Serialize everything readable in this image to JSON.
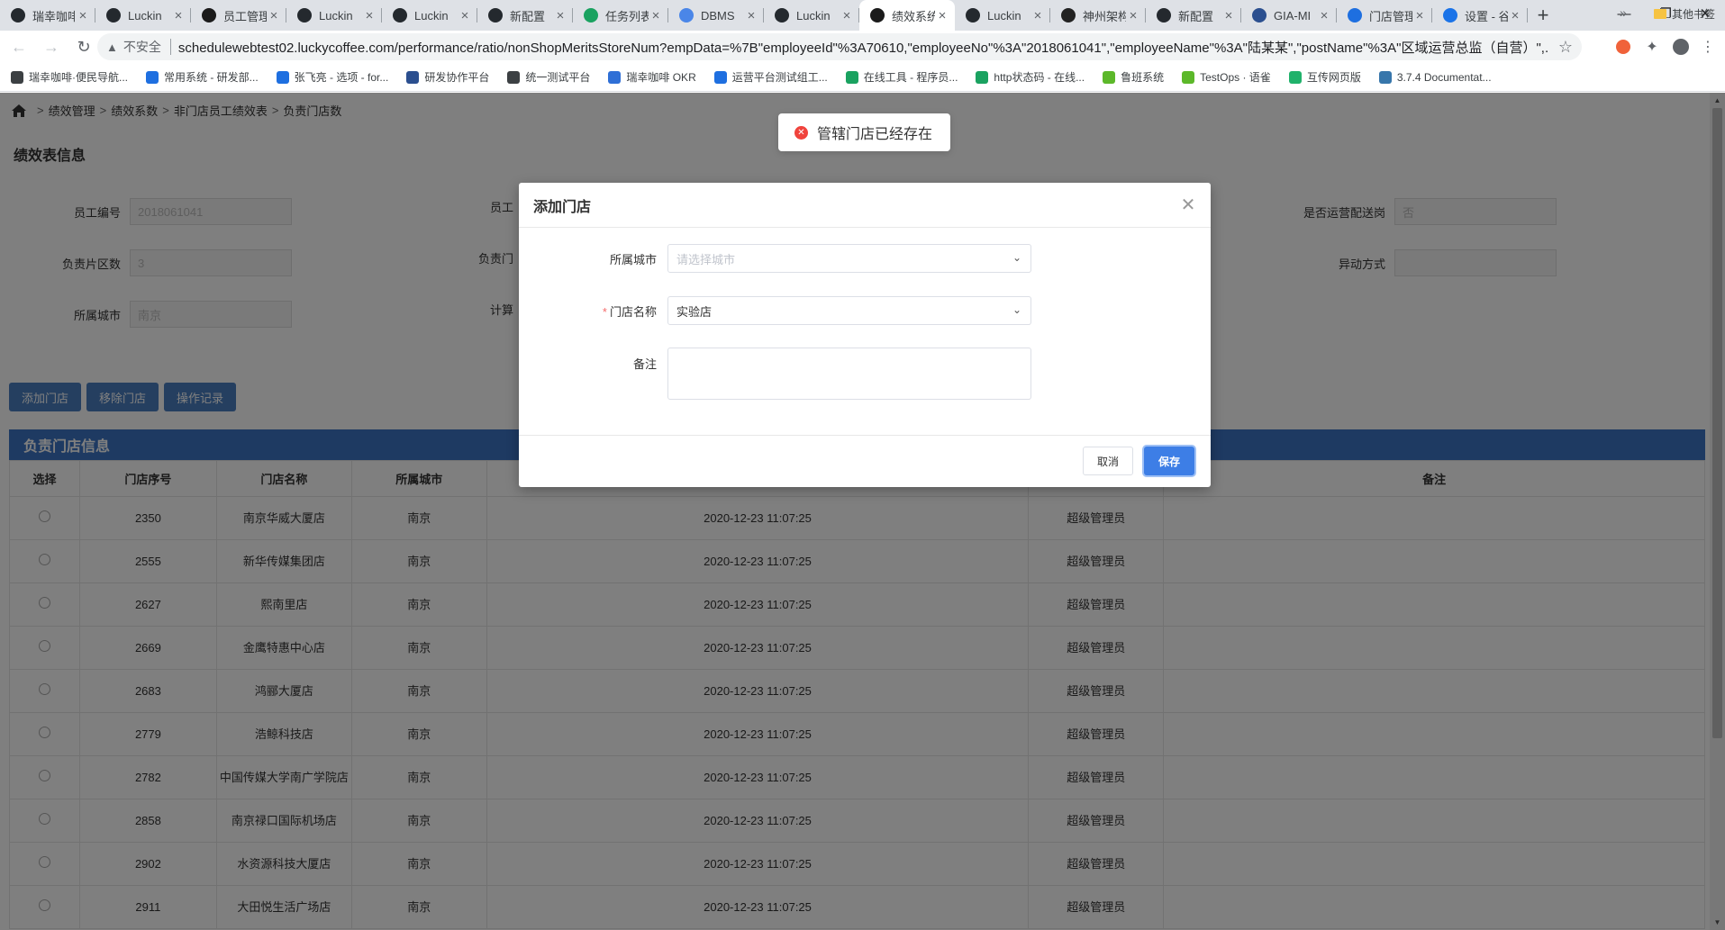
{
  "browser": {
    "tabs": [
      {
        "title": "瑞幸咖啡",
        "icon": "github-icon",
        "active": false
      },
      {
        "title": "Luckin",
        "icon": "github-icon",
        "active": false
      },
      {
        "title": "员工管理",
        "icon": "luckin-icon",
        "active": false
      },
      {
        "title": "Luckin",
        "icon": "github-icon",
        "active": false
      },
      {
        "title": "Luckin",
        "icon": "github-icon",
        "active": false
      },
      {
        "title": "新配置",
        "icon": "github-icon",
        "active": false
      },
      {
        "title": "任务列表",
        "icon": "clock-icon",
        "active": false
      },
      {
        "title": "DBMS",
        "icon": "doc-icon",
        "active": false
      },
      {
        "title": "Luckin",
        "icon": "github-icon",
        "active": false
      },
      {
        "title": "绩效系统",
        "icon": "luckin-icon",
        "active": true
      },
      {
        "title": "Luckin",
        "icon": "github-icon",
        "active": false
      },
      {
        "title": "神州架构",
        "icon": "ucar-icon",
        "active": false
      },
      {
        "title": "新配置",
        "icon": "github-icon",
        "active": false
      },
      {
        "title": "GIA-MI",
        "icon": "gia-icon",
        "active": false
      },
      {
        "title": "门店管理",
        "icon": "confluence-icon",
        "active": false
      },
      {
        "title": "设置 - 谷",
        "icon": "gear-icon",
        "active": false
      }
    ],
    "new_tab": "+",
    "insecure_label": "不安全",
    "url": "schedulewebtest02.luckycoffee.com/performance/ratio/nonShopMeritsStoreNum?empData=%7B\"employeeId\"%3A70610,\"employeeNo\"%3A\"2018061041\",\"employeeName\"%3A\"陆某某\",\"postName\"%3A\"区域运营总监（自营）\",...",
    "bookmarks": [
      {
        "label": "瑞幸咖啡·便民导航...",
        "color": "#3c4043"
      },
      {
        "label": "常用系统 - 研发部...",
        "color": "#1e6fe0"
      },
      {
        "label": "张飞亮 - 选项 - for...",
        "color": "#1e6fe0"
      },
      {
        "label": "研发协作平台",
        "color": "#2b4f8f"
      },
      {
        "label": "统一测试平台",
        "color": "#3c4043"
      },
      {
        "label": "瑞幸咖啡 OKR",
        "color": "#2f6fd6"
      },
      {
        "label": "运营平台测试组工...",
        "color": "#1e6fe0"
      },
      {
        "label": "在线工具 - 程序员...",
        "color": "#1aa260"
      },
      {
        "label": "http状态码 - 在线...",
        "color": "#1aa260"
      },
      {
        "label": "鲁班系统",
        "color": "#5cb82a"
      },
      {
        "label": "TestOps · 语雀",
        "color": "#5cb82a"
      },
      {
        "label": "互传网页版",
        "color": "#20b26b"
      },
      {
        "label": "3.7.4 Documentat...",
        "color": "#3776ab"
      }
    ],
    "bookmarks_more": "»",
    "other_bookmarks": "其他书签"
  },
  "page": {
    "breadcrumb": [
      "绩效管理",
      "绩效系数",
      "非门店员工绩效表",
      "负责门店数"
    ],
    "section_title": "绩效表信息",
    "fields": [
      {
        "label": "员工编号",
        "value": "2018061041"
      },
      {
        "label": "员工",
        "value": ""
      },
      {
        "label": "是否运营配送岗",
        "value": "否"
      },
      {
        "label": "负责片区数",
        "value": "3"
      },
      {
        "label": "负责门",
        "value": ""
      },
      {
        "label": "异动方式",
        "value": ""
      },
      {
        "label": "所属城市",
        "value": "南京"
      },
      {
        "label": "计算",
        "value": ""
      }
    ],
    "buttons": {
      "add": "添加门店",
      "remove": "移除门店",
      "log": "操作记录"
    },
    "table_title": "负责门店信息",
    "columns": [
      "选择",
      "门店序号",
      "门店名称",
      "所属城市",
      "",
      "",
      "备注"
    ],
    "rows": [
      {
        "num": "2350",
        "name": "南京华威大厦店",
        "city": "南京",
        "time": "2020-12-23 11:07:25",
        "operator": "超级管理员",
        "remark": ""
      },
      {
        "num": "2555",
        "name": "新华传媒集团店",
        "city": "南京",
        "time": "2020-12-23 11:07:25",
        "operator": "超级管理员",
        "remark": ""
      },
      {
        "num": "2627",
        "name": "熙南里店",
        "city": "南京",
        "time": "2020-12-23 11:07:25",
        "operator": "超级管理员",
        "remark": ""
      },
      {
        "num": "2669",
        "name": "金鹰特惠中心店",
        "city": "南京",
        "time": "2020-12-23 11:07:25",
        "operator": "超级管理员",
        "remark": ""
      },
      {
        "num": "2683",
        "name": "鸿郦大厦店",
        "city": "南京",
        "time": "2020-12-23 11:07:25",
        "operator": "超级管理员",
        "remark": ""
      },
      {
        "num": "2779",
        "name": "浩鲸科技店",
        "city": "南京",
        "time": "2020-12-23 11:07:25",
        "operator": "超级管理员",
        "remark": ""
      },
      {
        "num": "2782",
        "name": "中国传媒大学南广学院店",
        "city": "南京",
        "time": "2020-12-23 11:07:25",
        "operator": "超级管理员",
        "remark": ""
      },
      {
        "num": "2858",
        "name": "南京禄口国际机场店",
        "city": "南京",
        "time": "2020-12-23 11:07:25",
        "operator": "超级管理员",
        "remark": ""
      },
      {
        "num": "2902",
        "name": "水资源科技大厦店",
        "city": "南京",
        "time": "2020-12-23 11:07:25",
        "operator": "超级管理员",
        "remark": ""
      },
      {
        "num": "2911",
        "name": "大田悦生活广场店",
        "city": "南京",
        "time": "2020-12-23 11:07:25",
        "operator": "超级管理员",
        "remark": ""
      }
    ]
  },
  "modal": {
    "title": "添加门店",
    "city_label": "所属城市",
    "city_placeholder": "请选择城市",
    "store_label": "门店名称",
    "store_required_mark": "*",
    "store_value": "实验店",
    "remark_label": "备注",
    "remark_value": "",
    "cancel": "取消",
    "save": "保存"
  },
  "toast": {
    "type": "error",
    "message": "管辖门店已经存在"
  },
  "colors": {
    "primary": "#4a7fc1",
    "table_header": "#3c74c4",
    "save_button": "#3d7ee6",
    "error": "#f0433c"
  }
}
